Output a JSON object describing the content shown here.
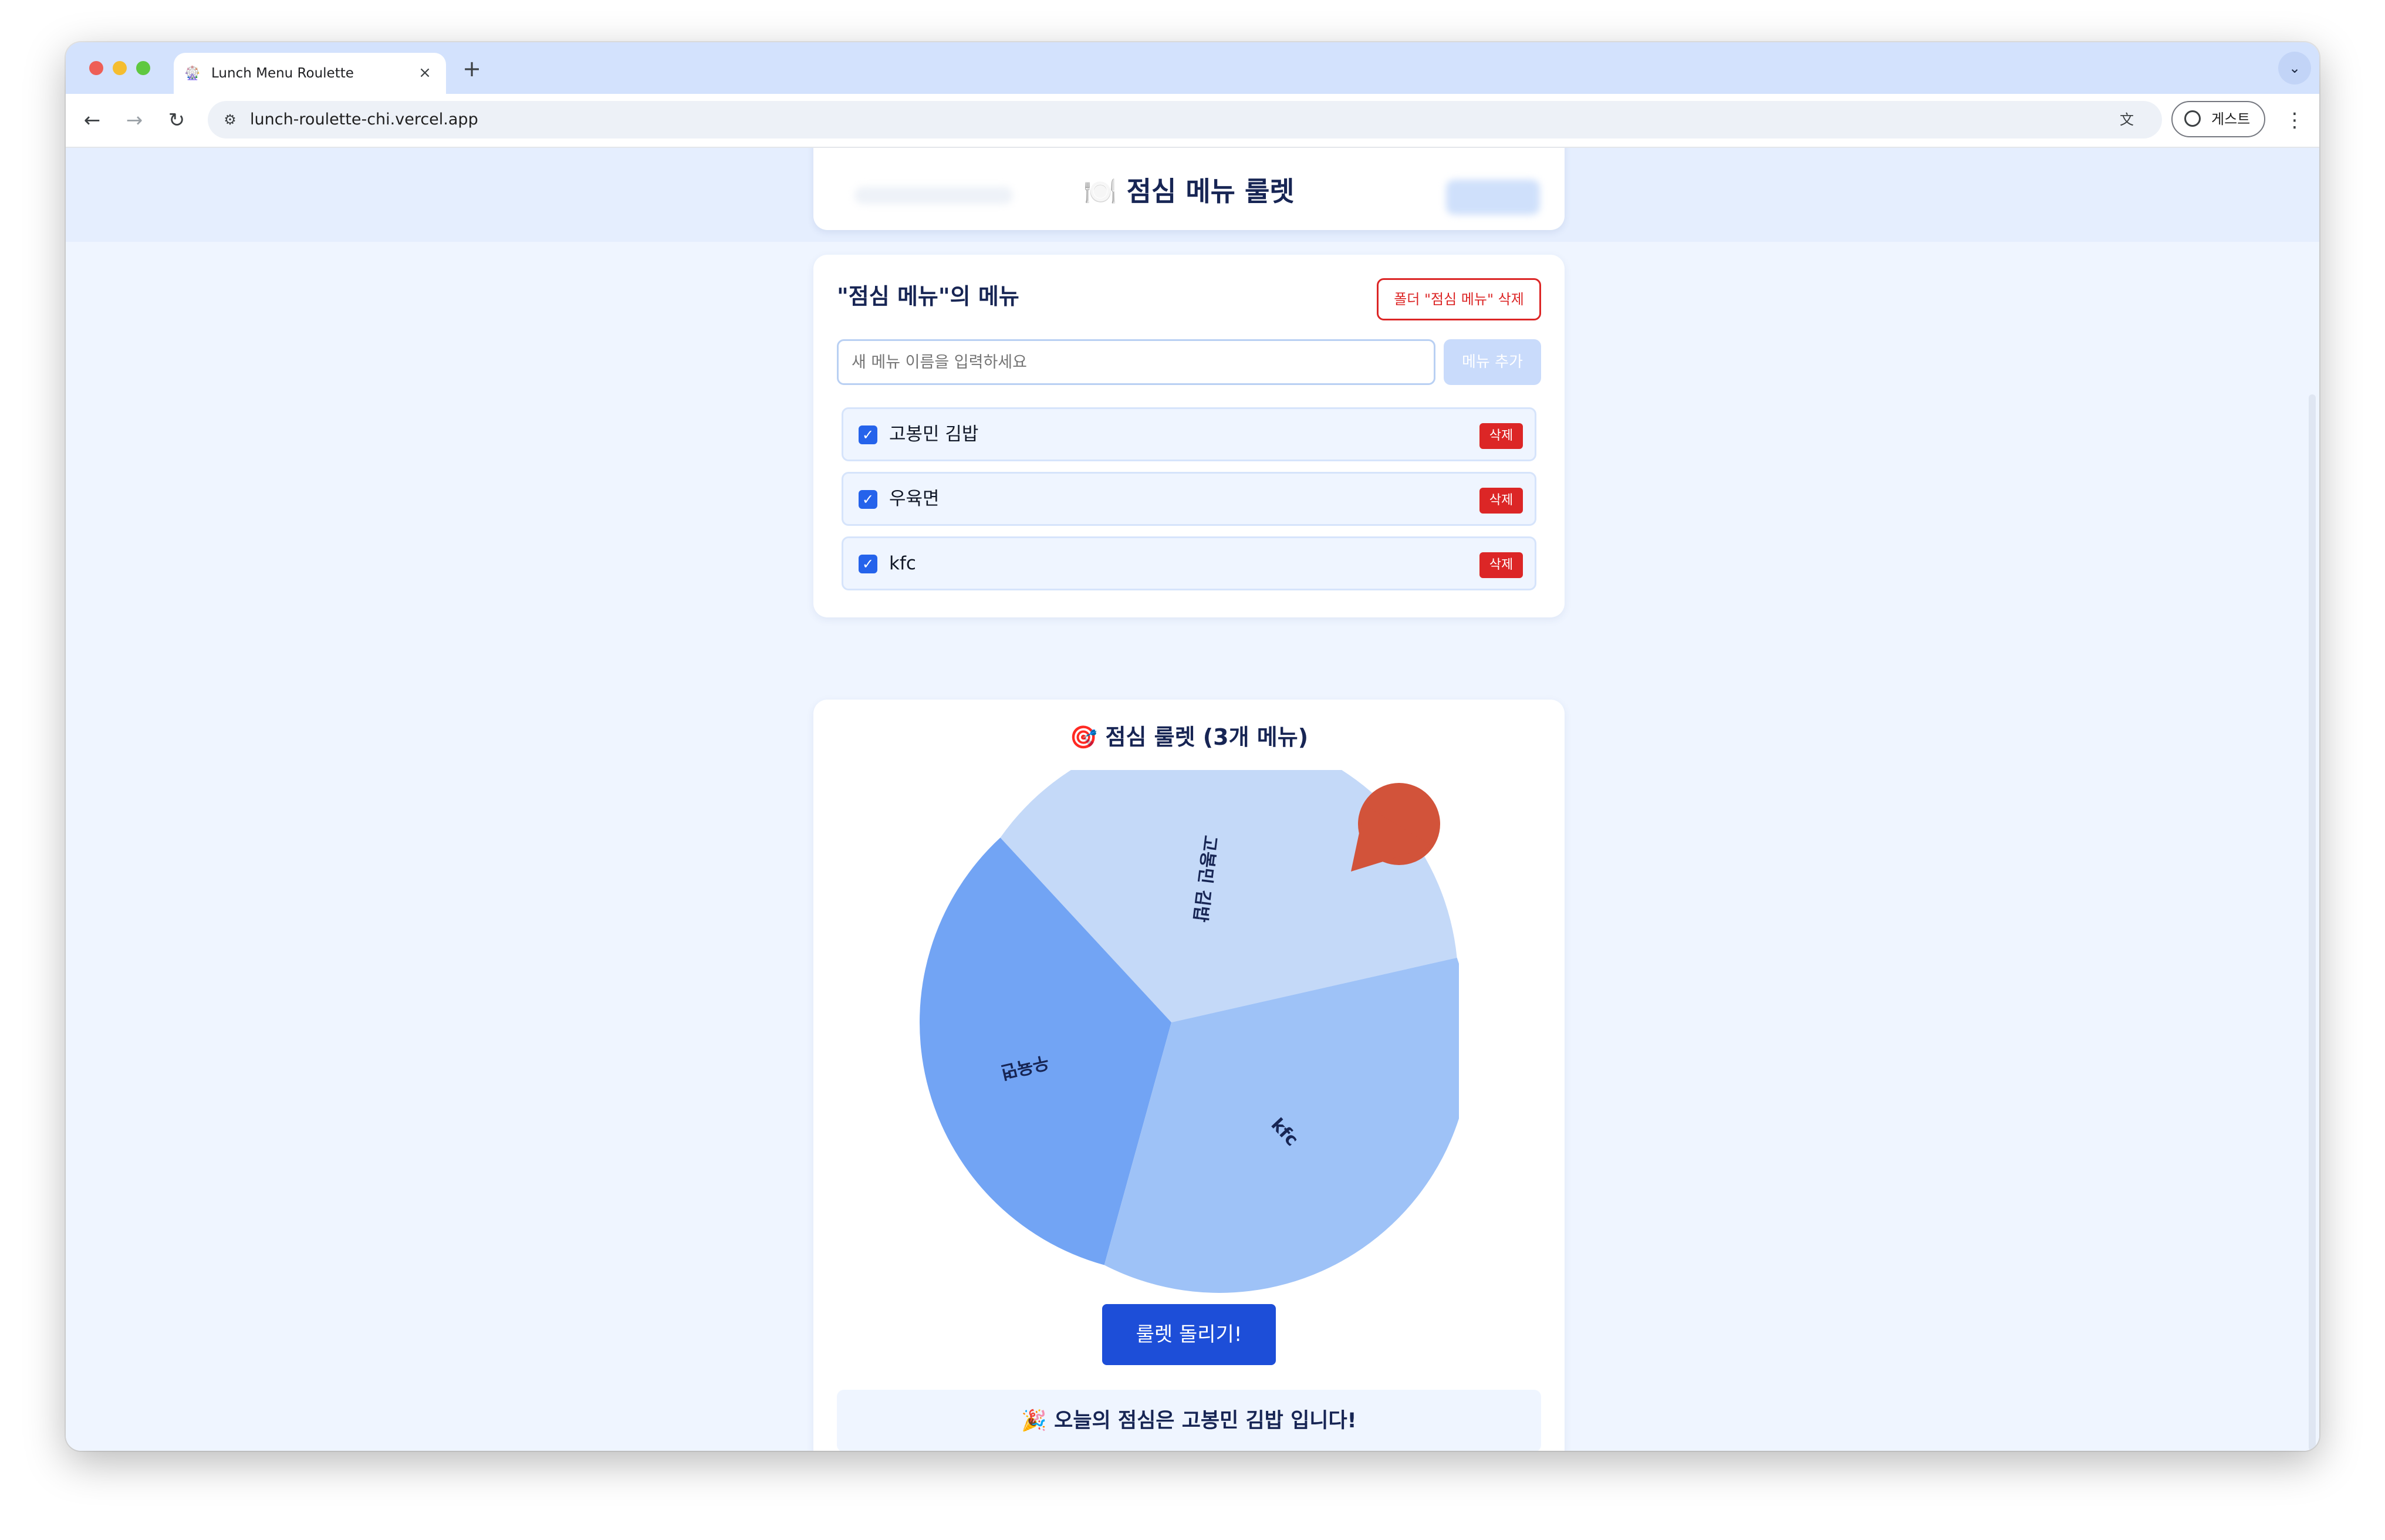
{
  "browser": {
    "tab_title": "Lunch Menu Roulette",
    "tab_favicon": "roulette-favicon",
    "url": "lunch-roulette-chi.vercel.app",
    "profile_label": "게스트",
    "traffic_colors": [
      "#ee5f57",
      "#f5bd2f",
      "#5fc840"
    ]
  },
  "header": {
    "icon": "🍽️",
    "title": "점심 메뉴 룰렛"
  },
  "menu_panel": {
    "heading": "\"점심 메뉴\"의 메뉴",
    "delete_folder_label": "폴더 \"점심 메뉴\" 삭제",
    "input_value": "",
    "input_placeholder": "새 메뉴 이름을 입력하세요",
    "add_label": "메뉴 추가",
    "items": [
      {
        "label": "고봉민 김밥",
        "checked": true,
        "delete_label": "삭제"
      },
      {
        "label": "우육면",
        "checked": true,
        "delete_label": "삭제"
      },
      {
        "label": "kfc",
        "checked": true,
        "delete_label": "삭제"
      }
    ]
  },
  "roulette": {
    "icon": "🎯",
    "heading": "점심 룰렛 (3개 메뉴)",
    "wheel": {
      "segments": [
        {
          "label": "고봉민 김밥",
          "color": "#c4d9f8"
        },
        {
          "label": "우육면",
          "color": "#72a4f4"
        },
        {
          "label": "kfc",
          "color": "#9ec2f7"
        }
      ],
      "pointer_color": "#d2533a"
    },
    "spin_label": "룰렛 돌리기!",
    "result_icon": "🎉",
    "result_text": "오늘의 점심은 고봉민 김밥 입니다!"
  }
}
